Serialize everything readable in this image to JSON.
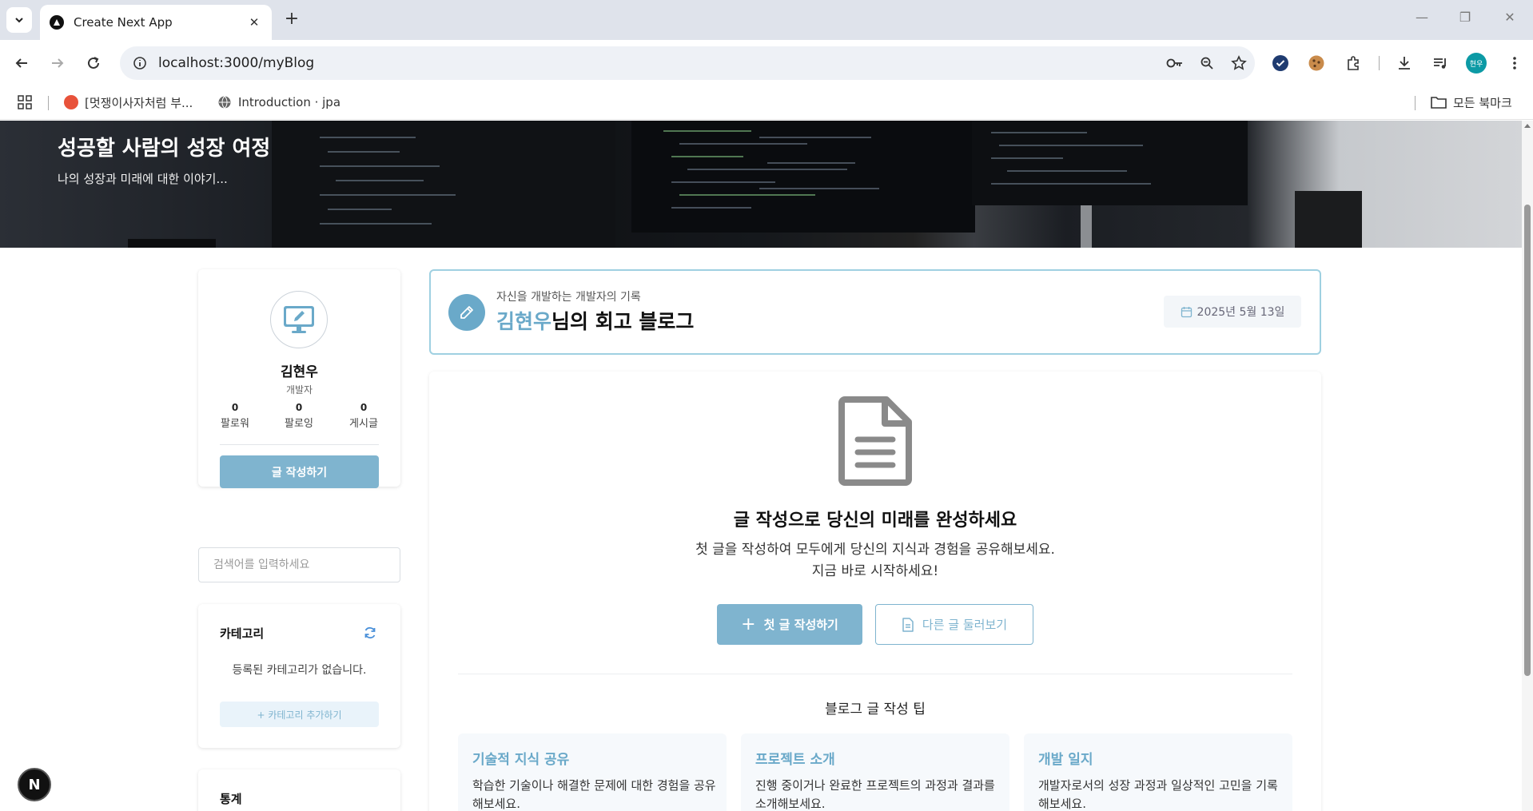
{
  "browser": {
    "tab_title": "Create Next App",
    "url": "localhost:3000/myBlog",
    "profile_initials": "현우",
    "bookmarks": [
      {
        "label": "[멋쟁이사자처럼 부..."
      },
      {
        "label": "Introduction · jpa"
      }
    ],
    "all_bookmarks_label": "모든 북마크"
  },
  "hero": {
    "title": "성공할 사람의 성장 여정",
    "subtitle": "나의 성장과 미래에 대한 이야기..."
  },
  "profile": {
    "name": "김현우",
    "role": "개발자",
    "stats": [
      {
        "value": "0",
        "label": "팔로워"
      },
      {
        "value": "0",
        "label": "팔로잉"
      },
      {
        "value": "0",
        "label": "게시글"
      }
    ],
    "write_button": "글 작성하기"
  },
  "search": {
    "placeholder": "검색어를 입력하세요"
  },
  "category": {
    "title": "카테고리",
    "empty_text": "등록된 카테고리가 없습니다.",
    "add_button": "+ 카테고리 추가하기"
  },
  "stats_section": {
    "title": "통계"
  },
  "blog_header": {
    "subtitle": "자신을 개발하는 개발자의 기록",
    "name": "김현우",
    "title_suffix": "님의 회고 블로그",
    "date": "2025년 5월 13일"
  },
  "empty_state": {
    "title": "글 작성으로 당신의 미래를 완성하세요",
    "desc_line1": "첫 글을 작성하여 모두에게 당신의 지식과 경험을 공유해보세요.",
    "desc_line2": "지금 바로 시작하세요!",
    "primary_button": "첫 글 작성하기",
    "secondary_button": "다른 글 둘러보기"
  },
  "tips": {
    "title": "블로그 글 작성 팁",
    "items": [
      {
        "title": "기술적 지식 공유",
        "desc": "학습한 기술이나 해결한 문제에 대한 경험을 공유해보세요."
      },
      {
        "title": "프로젝트 소개",
        "desc": "진행 중이거나 완료한 프로젝트의 과정과 결과를 소개해보세요."
      },
      {
        "title": "개발 일지",
        "desc": "개발자로서의 성장 과정과 일상적인 고민을 기록해보세요."
      }
    ]
  },
  "next_badge": "N",
  "colors": {
    "accent": "#7fb4cf",
    "accent_dark": "#6aa9c9",
    "header_border": "#9fd0e1"
  }
}
